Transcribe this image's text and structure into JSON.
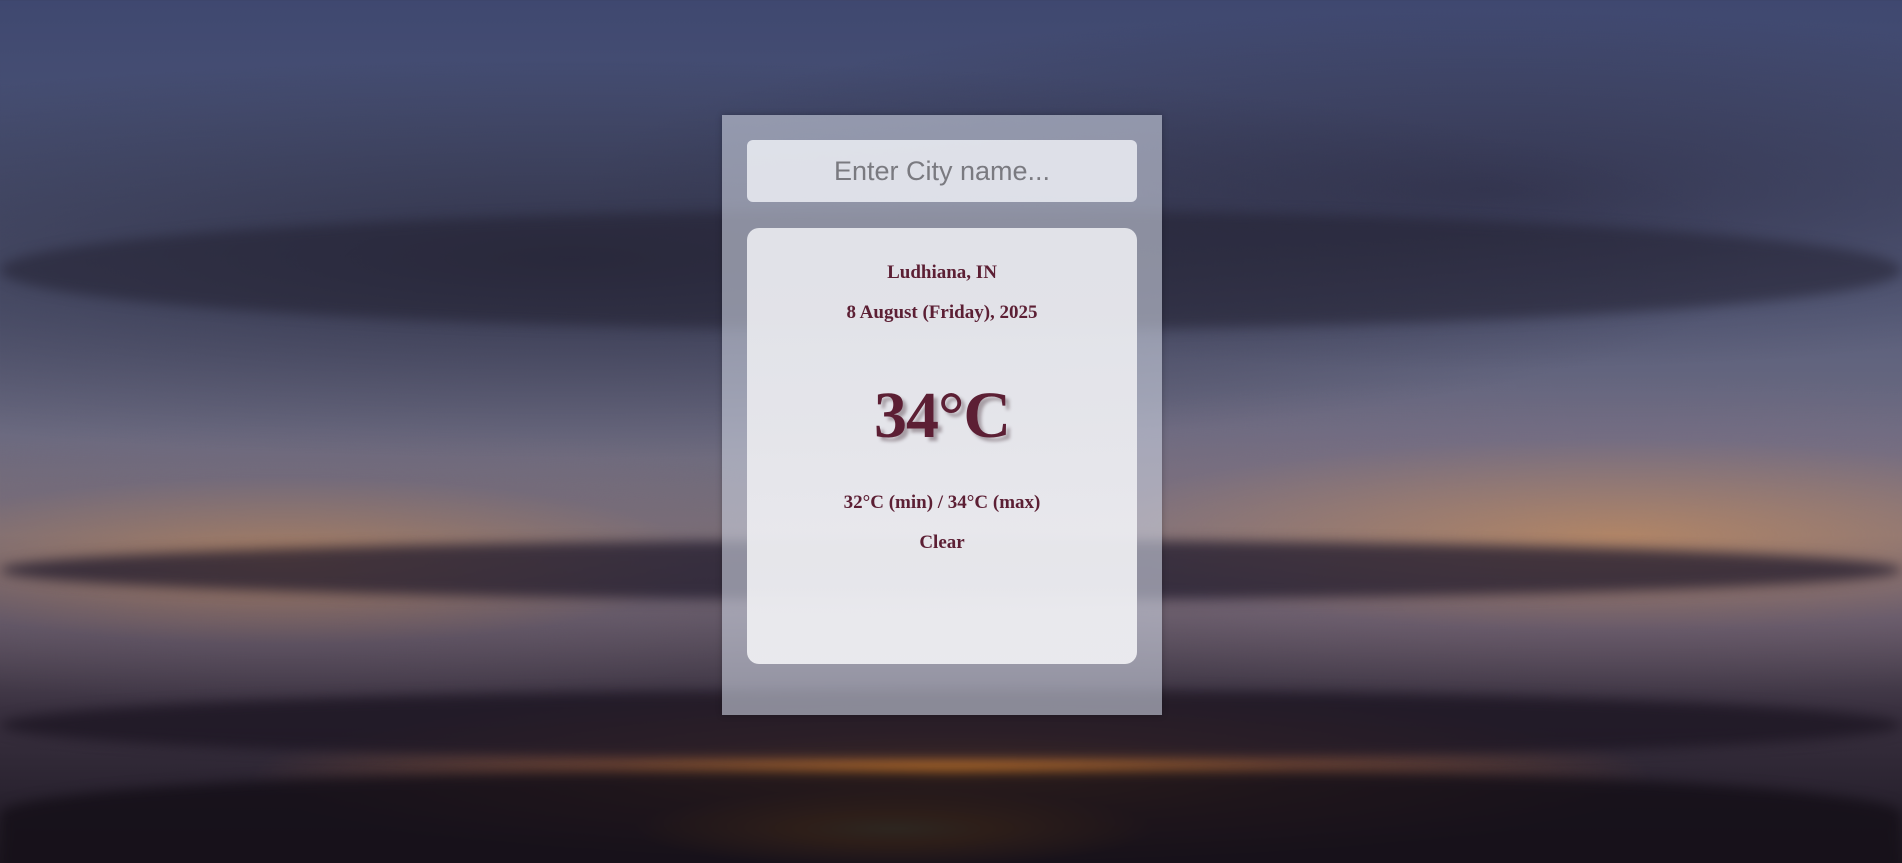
{
  "search": {
    "placeholder": "Enter City name...",
    "value": ""
  },
  "weather": {
    "location": "Ludhiana, IN",
    "date": "8 August (Friday), 2025",
    "temperature": "34°C",
    "min_max": "32°C (min) / 34°C (max)",
    "condition": "Clear"
  },
  "colors": {
    "text_accent": "#5c1f34"
  }
}
